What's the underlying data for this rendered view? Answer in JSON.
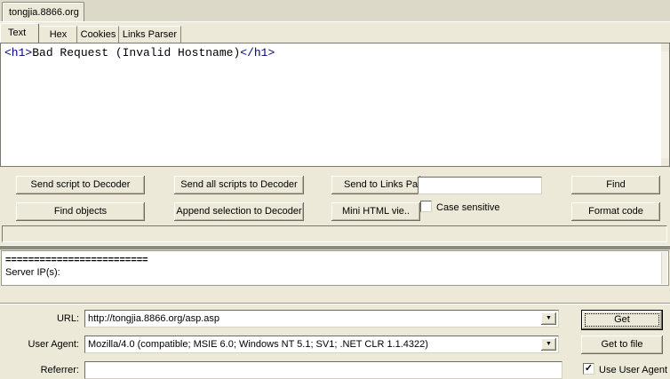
{
  "session": {
    "tab_label": "tongjia.8866.org"
  },
  "tabs": [
    {
      "label": "Text",
      "active": true
    },
    {
      "label": "Hex",
      "active": false
    },
    {
      "label": "Cookies",
      "active": false
    },
    {
      "label": "Links Parser",
      "active": false
    }
  ],
  "editor": {
    "open_tag": "<h1>",
    "body_text": "Bad Request (Invalid Hostname)",
    "close_tag": "</h1>"
  },
  "actions": {
    "send_script_label": "Send script to Decoder",
    "send_all_scripts_label": "Send all scripts to Decoder",
    "send_to_links_label": "Send to Links Pa",
    "find_label": "Find",
    "find_objects_label": "Find objects",
    "append_selection_label": "Append selection to Decoder",
    "mini_html_label": "Mini HTML vie..",
    "case_sensitive_label": "Case sensitive",
    "format_code_label": "Format code",
    "search_value": ""
  },
  "info_panel": {
    "separator": "=========================",
    "server_ips_label": "Server IP(s):"
  },
  "request_form": {
    "url_label": "URL:",
    "url_value": "http://tongjia.8866.org/asp.asp",
    "user_agent_label": "User Agent:",
    "user_agent_value": "Mozilla/4.0 (compatible; MSIE 6.0; Windows NT 5.1; SV1; .NET CLR 1.1.4322)",
    "referrer_label": "Referrer:",
    "referrer_value": "",
    "get_label": "Get",
    "get_to_file_label": "Get to file",
    "use_user_agent_label": "Use User Agent"
  },
  "icons": {
    "dropdown": "▼",
    "check": "✓"
  },
  "colors": {
    "window_face": "#ece9d8",
    "field_white": "#ffffff",
    "tag_navy": "#000080",
    "border_dark": "#6e6d62"
  }
}
